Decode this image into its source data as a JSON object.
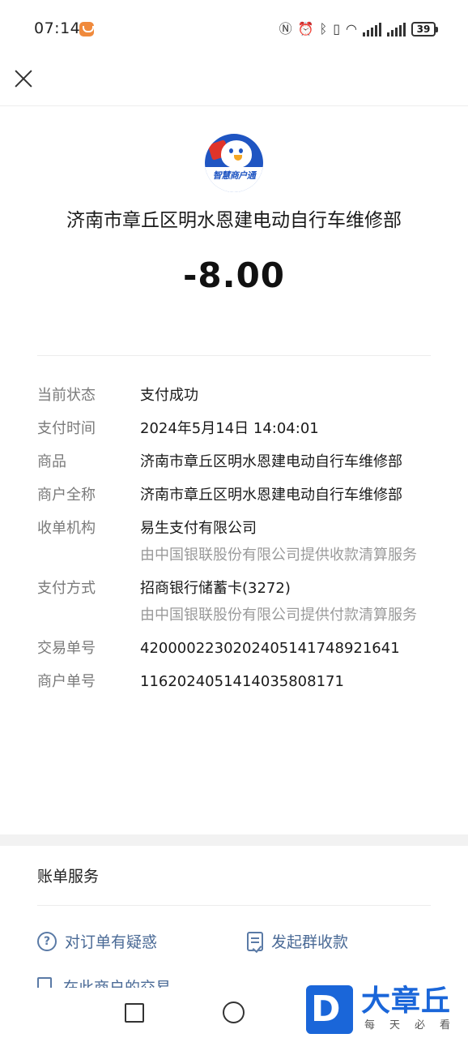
{
  "status_bar": {
    "time": "07:14",
    "battery": "39"
  },
  "merchant": {
    "logo_text": "智慧商户通",
    "name": "济南市章丘区明水恩建电动自行车维修部",
    "amount": "-8.00"
  },
  "details": {
    "status_label": "当前状态",
    "status_value": "支付成功",
    "time_label": "支付时间",
    "time_value": "2024年5月14日 14:04:01",
    "product_label": "商品",
    "product_value": "济南市章丘区明水恩建电动自行车维修部",
    "fullname_label": "商户全称",
    "fullname_value": "济南市章丘区明水恩建电动自行车维修部",
    "acquirer_label": "收单机构",
    "acquirer_value": "易生支付有限公司",
    "acquirer_note": "由中国银联股份有限公司提供收款清算服务",
    "method_label": "支付方式",
    "method_value": "招商银行储蓄卡(3272)",
    "method_note": "由中国银联股份有限公司提供付款清算服务",
    "txn_label": "交易单号",
    "txn_value": "4200002230202405141748921641",
    "merchant_no_label": "商户单号",
    "merchant_no_value": "1162024051414035808171"
  },
  "services": {
    "title": "账单服务",
    "question_label": "对订单有疑惑",
    "group_collect_label": "发起群收款",
    "cut_label": "在此商户的交易"
  },
  "watermark": {
    "letter": "D",
    "title": "大章丘",
    "subtitle": "每天必看"
  },
  "icons": {
    "close": "close-icon",
    "question": "question-circle-icon",
    "receipt": "receipt-check-icon",
    "list": "list-icon",
    "nav_recent": "square-icon",
    "nav_home": "circle-icon"
  },
  "colors": {
    "link": "#4a6a96",
    "logo_blue": "#1f55c2",
    "watermark_blue": "#1a66d9"
  }
}
